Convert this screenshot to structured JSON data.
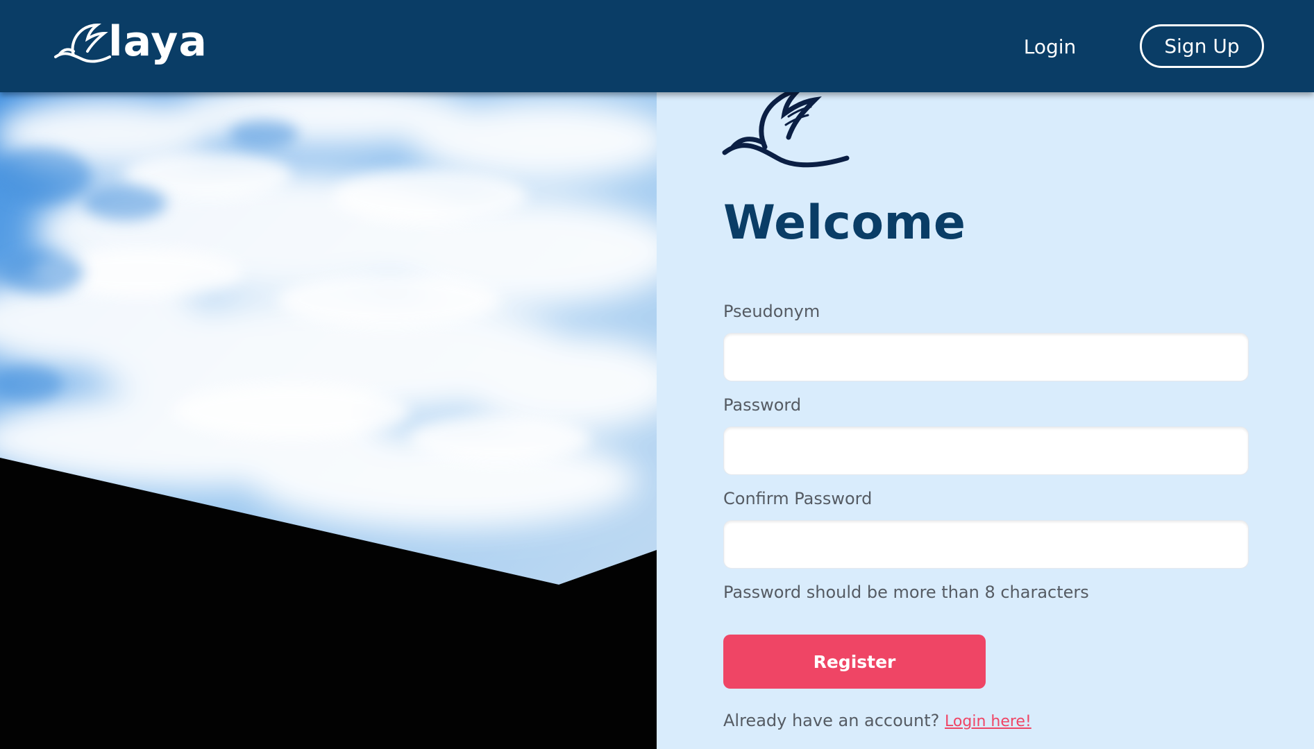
{
  "header": {
    "brand_name": "laya",
    "brand_icon": "dove-icon",
    "login_label": "Login",
    "signup_label": "Sign Up"
  },
  "hero": {
    "image": "sky-clouds-rooftop-photo"
  },
  "form": {
    "logo_icon": "dove-icon",
    "title": "Welcome",
    "fields": [
      {
        "label": "Pseudonym",
        "value": "",
        "placeholder": ""
      },
      {
        "label": "Password",
        "value": "",
        "placeholder": ""
      },
      {
        "label": "Confirm Password",
        "value": "",
        "placeholder": ""
      }
    ],
    "hint": "Password should be more than 8 characters",
    "register_label": "Register",
    "footer_text": "Already have an account?",
    "footer_link": "Login here!"
  },
  "colors": {
    "header_bg": "#0a3d66",
    "panel_bg": "#d9ecfc",
    "accent": "#ef4565",
    "title": "#0a3d66"
  }
}
